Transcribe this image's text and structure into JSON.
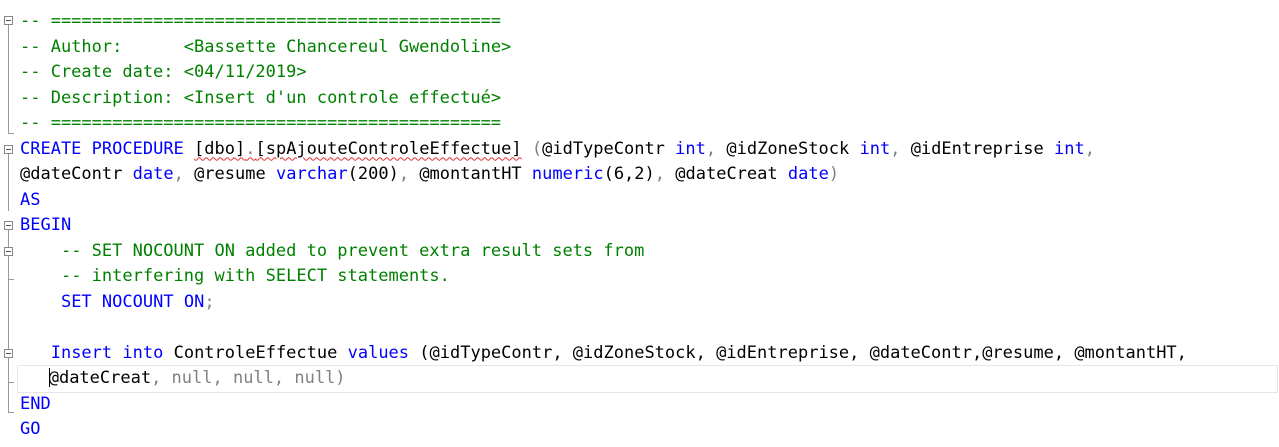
{
  "code": {
    "header_border": "-- ============================================",
    "author_label": "-- Author:",
    "author_value": "<Bassette Chancereul Gwendoline>",
    "date_label": "-- Create date:",
    "date_value": "<04/11/2019>",
    "desc_label": "-- Description:",
    "desc_value": "<Insert d'un controle effectué>",
    "kw_create": "CREATE",
    "kw_procedure": "PROCEDURE",
    "proc_schema": "[dbo]",
    "dot": ".",
    "proc_name": "[spAjouteControleEffectue]",
    "p_open": "(",
    "p_idTypeContr": "@idTypeContr",
    "t_int": "int",
    "comma": ",",
    "p_idZoneStock": "@idZoneStock",
    "p_idEntreprise": "@idEntreprise",
    "p_dateContr": "@dateContr",
    "t_date": "date",
    "p_resume": "@resume",
    "t_varchar": "varchar",
    "varchar_len": "(200)",
    "p_montantHT": "@montantHT",
    "t_numeric": "numeric",
    "numeric_len": "(6,2)",
    "p_dateCreat": "@dateCreat",
    "p_close": ")",
    "kw_as": "AS",
    "kw_begin": "BEGIN",
    "comment_nocount_1": "-- SET NOCOUNT ON added to prevent extra result sets from",
    "comment_nocount_2": "-- interfering with SELECT statements.",
    "kw_set": "SET",
    "kw_nocount": "NOCOUNT",
    "kw_on": "ON",
    "semicolon": ";",
    "kw_insert": "Insert",
    "kw_into": "into",
    "table_name": "ControleEffectue",
    "kw_values": "values",
    "insert_args_1": "(@idTypeContr, @idZoneStock, @idEntreprise, @dateContr,@resume, @montantHT,",
    "insert_var_last": "@dateCreat",
    "null_tail": ", null, null, null)",
    "kw_end": "END",
    "kw_go": "GO"
  },
  "colors": {
    "comment": "#008000",
    "keyword": "#0000ff",
    "operator": "#808080",
    "squiggle": "#e03030"
  },
  "icons": [
    "collapse-icon"
  ]
}
